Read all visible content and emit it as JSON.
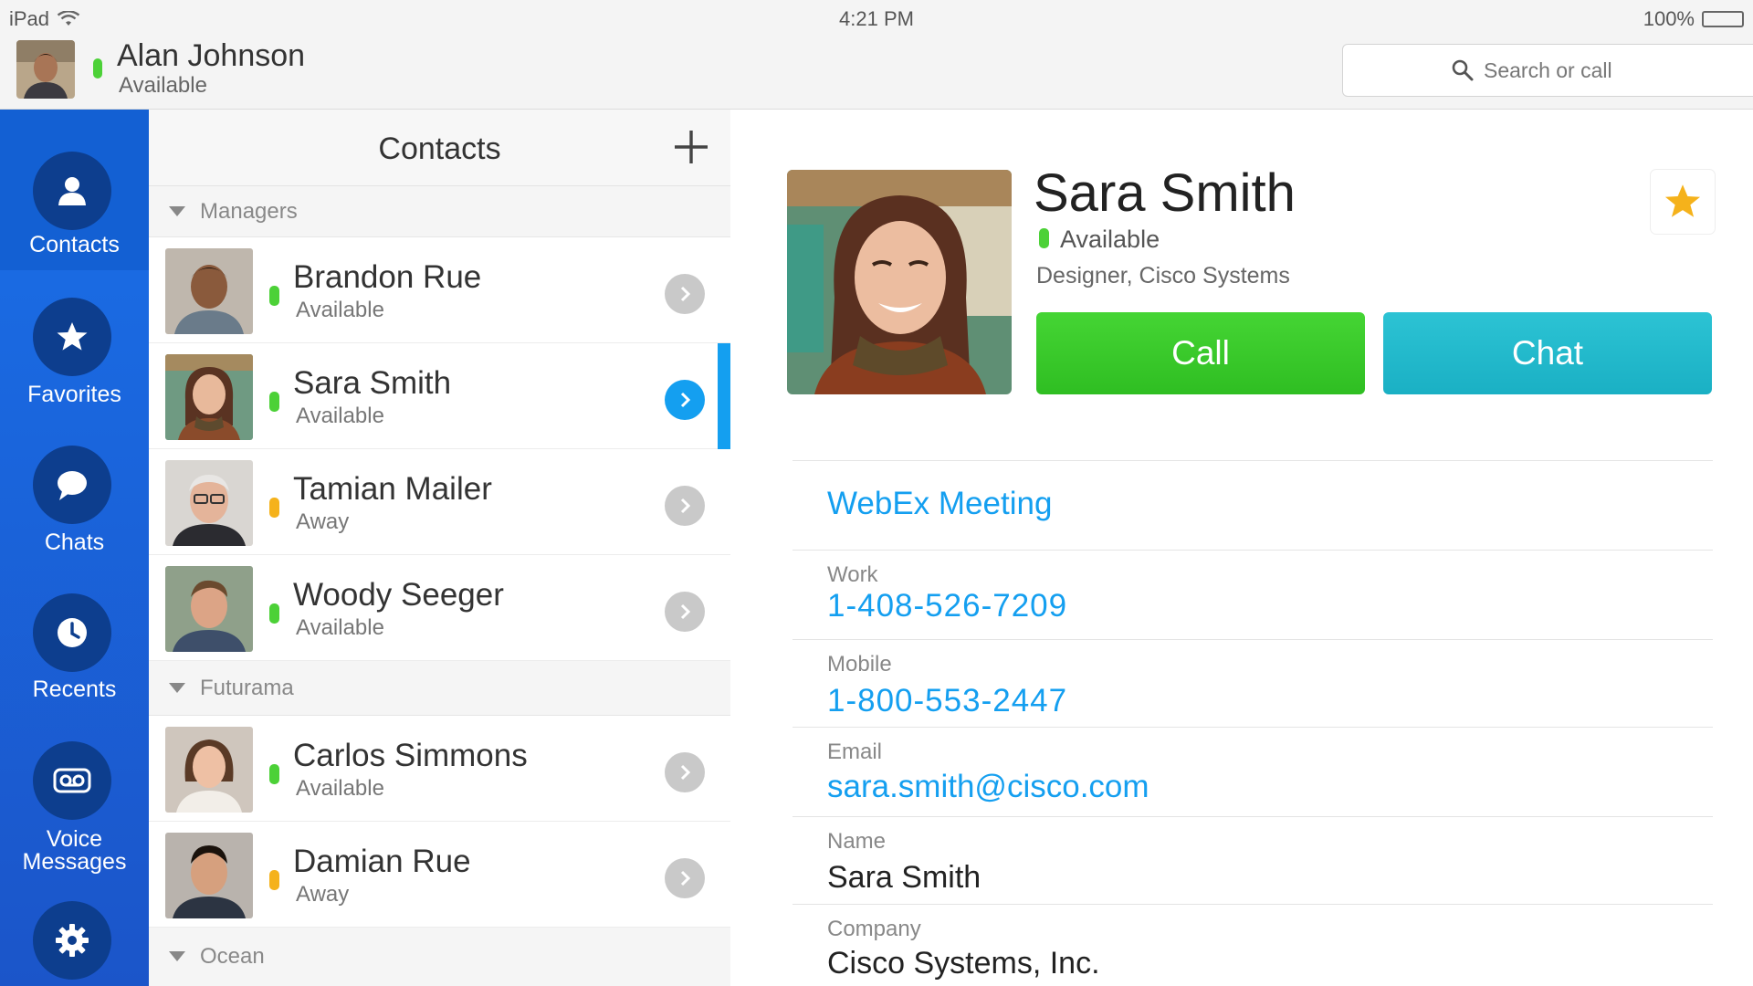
{
  "status_bar": {
    "device": "iPad",
    "time": "4:21 PM",
    "battery": "100%"
  },
  "user": {
    "name": "Alan Johnson",
    "status": "Available"
  },
  "search": {
    "placeholder": "Search or call"
  },
  "nav": {
    "items": [
      {
        "label": "Contacts",
        "icon": "person-icon"
      },
      {
        "label": "Favorites",
        "icon": "star-icon"
      },
      {
        "label": "Chats",
        "icon": "chat-bubble-icon"
      },
      {
        "label": "Recents",
        "icon": "clock-icon"
      },
      {
        "label": "Voice Messages",
        "icon": "voicemail-icon"
      },
      {
        "icon": "gear-icon"
      }
    ]
  },
  "contacts": {
    "title": "Contacts",
    "groups": [
      {
        "name": "Managers",
        "contacts": [
          {
            "name": "Brandon Rue",
            "status": "Available"
          },
          {
            "name": "Sara Smith",
            "status": "Available"
          },
          {
            "name": "Tamian Mailer",
            "status": "Away"
          },
          {
            "name": "Woody Seeger",
            "status": "Available"
          }
        ]
      },
      {
        "name": "Futurama",
        "contacts": [
          {
            "name": "Carlos Simmons",
            "status": "Available"
          },
          {
            "name": "Damian Rue",
            "status": "Away"
          }
        ]
      },
      {
        "name": "Ocean",
        "contacts": []
      }
    ]
  },
  "detail": {
    "name": "Sara Smith",
    "status": "Available",
    "title": "Designer, Cisco Systems",
    "call_label": "Call",
    "chat_label": "Chat",
    "webex_label": "WebEx Meeting",
    "fields": {
      "work_label": "Work",
      "work_value": "1-408-526-7209",
      "mobile_label": "Mobile",
      "mobile_value": "1-800-553-2447",
      "email_label": "Email",
      "email_value": "sara.smith@cisco.com",
      "name_label": "Name",
      "name_value": "Sara Smith",
      "company_label": "Company",
      "company_value": "Cisco Systems, Inc."
    }
  },
  "colors": {
    "accent": "#149ff0",
    "available": "#4cd137",
    "away": "#f5b21b",
    "call": "#35c727",
    "chat": "#20b8ca",
    "nav": "#1a64dc",
    "star": "#f5b21b"
  }
}
